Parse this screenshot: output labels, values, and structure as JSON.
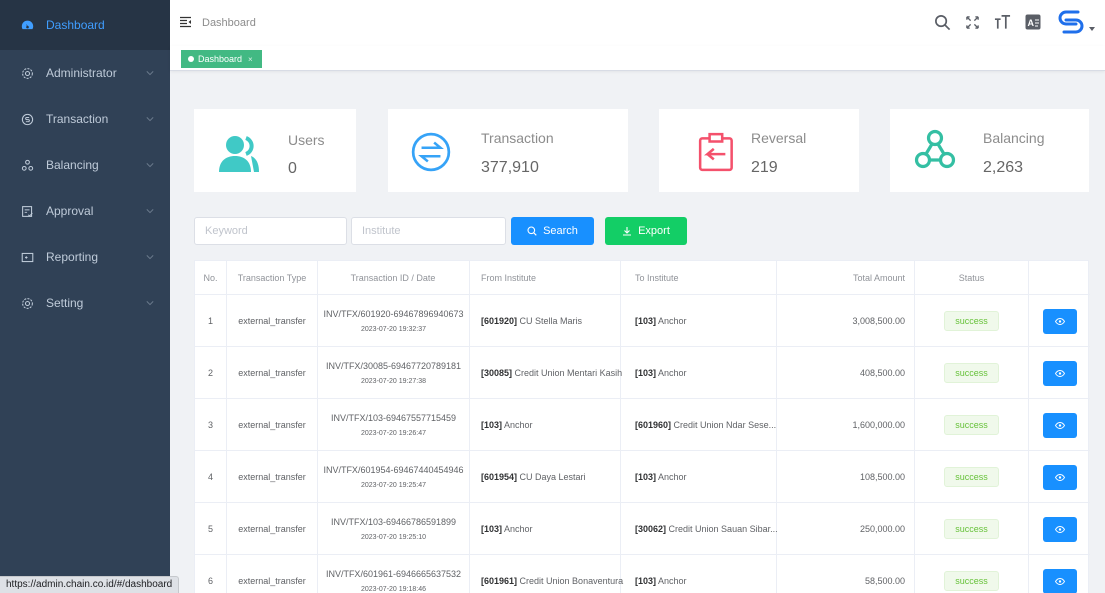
{
  "sidebar": {
    "items": [
      {
        "label": "Dashboard",
        "icon": "dashboard-icon",
        "active": true
      },
      {
        "label": "Administrator",
        "icon": "gear-icon"
      },
      {
        "label": "Transaction",
        "icon": "coin-icon"
      },
      {
        "label": "Balancing",
        "icon": "nodes-icon"
      },
      {
        "label": "Approval",
        "icon": "approval-icon"
      },
      {
        "label": "Reporting",
        "icon": "report-icon"
      },
      {
        "label": "Setting",
        "icon": "gear-icon"
      }
    ]
  },
  "header": {
    "title": "Dashboard",
    "icons": [
      "search-icon",
      "fullscreen-icon",
      "font-size-icon",
      "translate-icon",
      "user-logo"
    ]
  },
  "tags": {
    "active": "Dashboard"
  },
  "stats": [
    {
      "label": "Users",
      "value": "0",
      "icon": "users-icon",
      "color": "#36a3f7"
    },
    {
      "label": "Transaction",
      "value": "377,910",
      "icon": "exchange-icon",
      "color": "#40c9c6"
    },
    {
      "label": "Reversal",
      "value": "219",
      "icon": "reversal-icon",
      "color": "#f4516c"
    },
    {
      "label": "Balancing",
      "value": "2,263",
      "icon": "balancing-icon",
      "color": "#34bfa3"
    }
  ],
  "filters": {
    "keyword_placeholder": "Keyword",
    "institute_placeholder": "Institute",
    "search_label": "Search",
    "export_label": "Export"
  },
  "table": {
    "headers": [
      "No.",
      "Transaction Type",
      "Transaction ID / Date",
      "From Institute",
      "To Institute",
      "Total Amount",
      "Status",
      ""
    ],
    "rows": [
      {
        "no": "1",
        "type": "external_transfer",
        "id": "INV/TFX/601920-69467896940673",
        "date": "2023-07-20 19:32:37",
        "from_code": "[601920]",
        "from_name": " CU Stella Maris",
        "to_code": "[103]",
        "to_name": " Anchor",
        "amount": "3,008,500.00",
        "status": "success"
      },
      {
        "no": "2",
        "type": "external_transfer",
        "id": "INV/TFX/30085-69467720789181",
        "date": "2023-07-20 19:27:38",
        "from_code": "[30085]",
        "from_name": " Credit Union Mentari Kasih",
        "to_code": "[103]",
        "to_name": " Anchor",
        "amount": "408,500.00",
        "status": "success"
      },
      {
        "no": "3",
        "type": "external_transfer",
        "id": "INV/TFX/103-69467557715459",
        "date": "2023-07-20 19:26:47",
        "from_code": "[103]",
        "from_name": " Anchor",
        "to_code": "[601960]",
        "to_name": " Credit Union Ndar Sese...",
        "amount": "1,600,000.00",
        "status": "success"
      },
      {
        "no": "4",
        "type": "external_transfer",
        "id": "INV/TFX/601954-69467440454946",
        "date": "2023-07-20 19:25:47",
        "from_code": "[601954]",
        "from_name": " CU Daya Lestari",
        "to_code": "[103]",
        "to_name": " Anchor",
        "amount": "108,500.00",
        "status": "success"
      },
      {
        "no": "5",
        "type": "external_transfer",
        "id": "INV/TFX/103-69466786591899",
        "date": "2023-07-20 19:25:10",
        "from_code": "[103]",
        "from_name": " Anchor",
        "to_code": "[30062]",
        "to_name": " Credit Union Sauan Sibar...",
        "amount": "250,000.00",
        "status": "success"
      },
      {
        "no": "6",
        "type": "external_transfer",
        "id": "INV/TFX/601961-6946665637532",
        "date": "2023-07-20 19:18:46",
        "from_code": "[601961]",
        "from_name": " Credit Union Bonaventura",
        "to_code": "[103]",
        "to_name": " Anchor",
        "amount": "58,500.00",
        "status": "success"
      }
    ]
  },
  "statusbar": {
    "url": "https://admin.chain.co.id/#/dashboard"
  }
}
